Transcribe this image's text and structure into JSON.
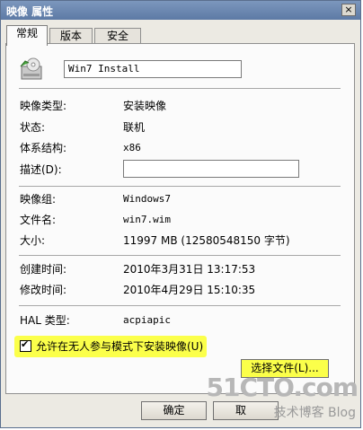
{
  "window": {
    "title": "映像 属性",
    "close_glyph": "×"
  },
  "tabs": [
    {
      "label": "常规",
      "active": true
    },
    {
      "label": "版本",
      "active": false
    },
    {
      "label": "安全",
      "active": false
    }
  ],
  "general": {
    "image_name": "Win7 Install",
    "rows": [
      {
        "label": "映像类型:",
        "value": "安装映像"
      },
      {
        "label": "状态:",
        "value": "联机"
      },
      {
        "label": "体系结构:",
        "value": "x86"
      }
    ],
    "description_label": "描述(D):",
    "description_value": "",
    "rows2": [
      {
        "label": "映像组:",
        "value": "Windows7"
      },
      {
        "label": "文件名:",
        "value": "win7.wim"
      },
      {
        "label": "大小:",
        "value": "11997 MB (12580548150 字节)"
      }
    ],
    "rows3": [
      {
        "label": "创建时间:",
        "value": "2010年3月31日 13:17:53"
      },
      {
        "label": "修改时间:",
        "value": "2010年4月29日 15:10:35"
      }
    ],
    "hal_label": "HAL 类型:",
    "hal_value": "acpiapic",
    "unattend_checkbox": {
      "label": "允许在无人参与模式下安装映像(U)",
      "checked": true,
      "check_glyph": "✔"
    },
    "select_file_button": "选择文件(L)..."
  },
  "footer": {
    "ok_button": "确定",
    "cancel_button": "取"
  },
  "watermark": {
    "text_big": "51CTO.com",
    "text_small": "技术博客 Blog"
  },
  "icon": "cd-drive-icon"
}
